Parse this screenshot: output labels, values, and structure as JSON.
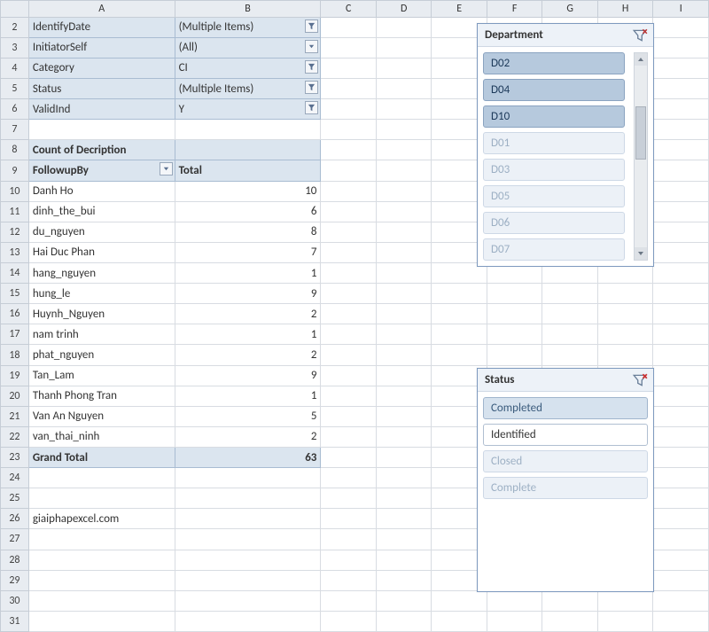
{
  "columns": [
    "A",
    "B",
    "C",
    "D",
    "E",
    "F",
    "G",
    "H",
    "I"
  ],
  "rowStart": 2,
  "rowEnd": 31,
  "filters": [
    {
      "label": "IdentifyDate",
      "value": "(Multiple Items)",
      "active": true
    },
    {
      "label": "InitiatorSelf",
      "value": "(All)",
      "active": false
    },
    {
      "label": "Category",
      "value": "CI",
      "active": true
    },
    {
      "label": "Status",
      "value": "(Multiple Items)",
      "active": true
    },
    {
      "label": "ValidInd",
      "value": "Y",
      "active": true
    }
  ],
  "pivot": {
    "title": "Count of Decription",
    "rowField": "FollowupBy",
    "colLabel": "Total",
    "rows": [
      {
        "name": "Danh Ho",
        "val": "10"
      },
      {
        "name": "dinh_the_bui",
        "val": "6"
      },
      {
        "name": "du_nguyen",
        "val": "8"
      },
      {
        "name": "Hai Duc Phan",
        "val": "7"
      },
      {
        "name": "hang_nguyen",
        "val": "1"
      },
      {
        "name": "hung_le",
        "val": "9"
      },
      {
        "name": "Huynh_Nguyen",
        "val": "2"
      },
      {
        "name": "nam trinh",
        "val": "1"
      },
      {
        "name": "phat_nguyen",
        "val": "2"
      },
      {
        "name": "Tan_Lam",
        "val": "9"
      },
      {
        "name": "Thanh Phong Tran",
        "val": "1"
      },
      {
        "name": "Van An Nguyen",
        "val": "5"
      },
      {
        "name": "van_thai_ninh",
        "val": "2"
      }
    ],
    "grandLabel": "Grand Total",
    "grandVal": "63"
  },
  "note": "giaiphapexcel.com",
  "slicers": {
    "department": {
      "title": "Department",
      "items": [
        {
          "label": "D02",
          "state": "sel-dark"
        },
        {
          "label": "D04",
          "state": "sel-dark"
        },
        {
          "label": "D10",
          "state": "sel-dark"
        },
        {
          "label": "D01",
          "state": "dim"
        },
        {
          "label": "D03",
          "state": "dim"
        },
        {
          "label": "D05",
          "state": "dim"
        },
        {
          "label": "D06",
          "state": "dim"
        },
        {
          "label": "D07",
          "state": "dim"
        }
      ]
    },
    "status": {
      "title": "Status",
      "items": [
        {
          "label": "Completed",
          "state": "sel-light"
        },
        {
          "label": "Identified",
          "state": "white"
        },
        {
          "label": "Closed",
          "state": "dim"
        },
        {
          "label": "Complete",
          "state": "dim"
        }
      ]
    }
  }
}
